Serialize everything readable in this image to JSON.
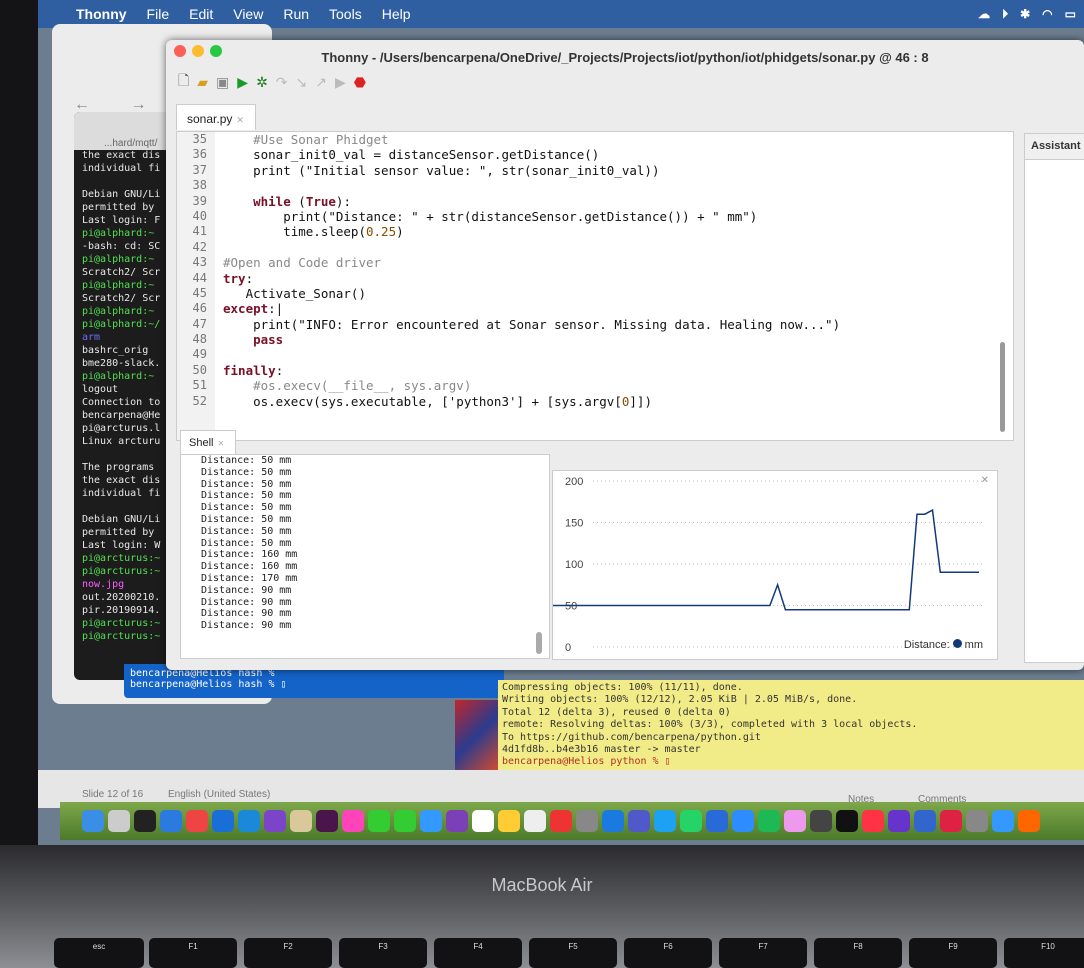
{
  "menubar": {
    "app": "Thonny",
    "items": [
      "File",
      "Edit",
      "View",
      "Run",
      "Tools",
      "Help"
    ]
  },
  "window": {
    "title": "Thonny  -  /Users/bencarpena/OneDrive/_Projects/Projects/iot/python/iot/phidgets/sonar.py  @  46 : 8"
  },
  "browser": {
    "nav": "← → C"
  },
  "editor": {
    "tab": "sonar.py",
    "lines": [
      {
        "n": "35",
        "html": "    <span class='cm'>#Use Sonar Phidget</span>"
      },
      {
        "n": "36",
        "html": "    sonar_init0_val = distanceSensor.getDistance()"
      },
      {
        "n": "37",
        "html": "    print (\"Initial sensor value: \", str(sonar_init0_val))"
      },
      {
        "n": "38",
        "html": ""
      },
      {
        "n": "39",
        "html": "    <span class='kw'>while</span> (<span class='kw'>True</span>):"
      },
      {
        "n": "40",
        "html": "        print(\"Distance: \" + str(distanceSensor.getDistance()) + \" mm\")"
      },
      {
        "n": "41",
        "html": "        time.sleep(<span class='nm'>0.25</span>)"
      },
      {
        "n": "42",
        "html": ""
      },
      {
        "n": "43",
        "html": "<span class='cm'>#Open and Code driver</span>"
      },
      {
        "n": "44",
        "html": "<span class='kw'>try</span>:"
      },
      {
        "n": "45",
        "html": "   Activate_Sonar()"
      },
      {
        "n": "46",
        "html": "<span class='kw'>except</span>:|"
      },
      {
        "n": "47",
        "html": "    print(\"INFO: Error encountered at Sonar sensor. Missing data. Healing now...\")"
      },
      {
        "n": "48",
        "html": "    <span class='kw'>pass</span>"
      },
      {
        "n": "49",
        "html": ""
      },
      {
        "n": "50",
        "html": "<span class='kw'>finally</span>:"
      },
      {
        "n": "51",
        "html": "    <span class='cm'>#os.execv(__file__, sys.argv)</span>"
      },
      {
        "n": "52",
        "html": "    os.execv(sys.executable, ['python3'] + [sys.argv[<span class='nm'>0</span>]])"
      }
    ]
  },
  "assistant": {
    "title": "Assistant"
  },
  "shell": {
    "tab": "Shell",
    "lines": [
      "Distance: 50 mm",
      "Distance: 50 mm",
      "Distance: 50 mm",
      "Distance: 50 mm",
      "Distance: 50 mm",
      "Distance: 50 mm",
      "Distance: 50 mm",
      "Distance: 50 mm",
      "Distance: 160 mm",
      "Distance: 160 mm",
      "Distance: 170 mm",
      "Distance: 90 mm",
      "Distance: 90 mm",
      "Distance: 90 mm",
      "Distance: 90 mm"
    ]
  },
  "plot": {
    "legend_label": "Distance:",
    "legend_unit": "mm",
    "line_color": "#123a7a"
  },
  "chart_data": {
    "type": "line",
    "ylim": [
      0,
      200
    ],
    "yticks": [
      0,
      50,
      100,
      150,
      200
    ],
    "series": [
      {
        "name": "Distance",
        "values": [
          50,
          50,
          50,
          50,
          50,
          50,
          50,
          50,
          50,
          50,
          50,
          50,
          50,
          50,
          50,
          50,
          50,
          50,
          50,
          50,
          50,
          50,
          50,
          50,
          50,
          50,
          50,
          50,
          50,
          75,
          45,
          45,
          45,
          45,
          45,
          45,
          45,
          45,
          45,
          45,
          45,
          45,
          45,
          45,
          45,
          45,
          45,
          160,
          160,
          165,
          90,
          90,
          90,
          90,
          90,
          90
        ]
      }
    ]
  },
  "terminal_left": {
    "title": "...hard/mqtt/",
    "lines": [
      {
        "t": "the exact dis",
        "c": ""
      },
      {
        "t": "individual fi",
        "c": ""
      },
      {
        "t": "",
        "c": ""
      },
      {
        "t": "Debian GNU/Li",
        "c": ""
      },
      {
        "t": "permitted by",
        "c": ""
      },
      {
        "t": "Last login: F",
        "c": ""
      },
      {
        "t": "pi@alphard:~",
        "c": "g"
      },
      {
        "t": "-bash: cd: SC",
        "c": ""
      },
      {
        "t": "pi@alphard:~",
        "c": "g"
      },
      {
        "t": "Scratch2/ Scr",
        "c": ""
      },
      {
        "t": "pi@alphard:~",
        "c": "g"
      },
      {
        "t": "Scratch2/ Scr",
        "c": ""
      },
      {
        "t": "pi@alphard:~",
        "c": "g"
      },
      {
        "t": "pi@alphard:~/",
        "c": "g"
      },
      {
        "t": "arm",
        "c": "b"
      },
      {
        "t": "bashrc_orig",
        "c": ""
      },
      {
        "t": "bme280-slack.",
        "c": ""
      },
      {
        "t": "pi@alphard:~",
        "c": "g"
      },
      {
        "t": "logout",
        "c": ""
      },
      {
        "t": "Connection to",
        "c": ""
      },
      {
        "t": "bencarpena@He",
        "c": ""
      },
      {
        "t": "pi@arcturus.l",
        "c": ""
      },
      {
        "t": "Linux arcturu",
        "c": ""
      },
      {
        "t": "",
        "c": ""
      },
      {
        "t": "The programs",
        "c": ""
      },
      {
        "t": "the exact dis",
        "c": ""
      },
      {
        "t": "individual fi",
        "c": ""
      },
      {
        "t": "",
        "c": ""
      },
      {
        "t": "Debian GNU/Li",
        "c": ""
      },
      {
        "t": "permitted by",
        "c": ""
      },
      {
        "t": "Last login: W",
        "c": ""
      },
      {
        "t": "pi@arcturus:~",
        "c": "g"
      },
      {
        "t": "pi@arcturus:~",
        "c": "g"
      },
      {
        "t": "now.jpg",
        "c": "m"
      },
      {
        "t": "out.20200210.",
        "c": ""
      },
      {
        "t": "pir.20190914.",
        "c": ""
      },
      {
        "t": "pi@arcturus:~",
        "c": "g"
      },
      {
        "t": "pi@arcturus:~",
        "c": "g"
      }
    ]
  },
  "terminal_blue": {
    "lines": [
      "bencarpena@Helios hash %",
      "bencarpena@Helios hash % ▯"
    ]
  },
  "terminal_git": {
    "lines": [
      "Compressing objects: 100% (11/11), done.",
      "Writing objects: 100% (12/12), 2.05 KiB | 2.05 MiB/s, done.",
      "Total 12 (delta 3), reused 0 (delta 0)",
      "remote: Resolving deltas: 100% (3/3), completed with 3 local objects.",
      "To https://github.com/bencarpena/python.git",
      "   4d1fd8b..b4e3b16  master -> master",
      "bencarpena@Helios python % ▯"
    ]
  },
  "ppt": {
    "slide": "Slide 12 of 16",
    "lang": "English (United States)",
    "notes": "Notes",
    "comments": "Comments"
  },
  "laptop": {
    "brand": "MacBook Air",
    "keys": [
      "esc",
      "F1",
      "F2",
      "F3",
      "F4",
      "F5",
      "F6",
      "F7",
      "F8",
      "F9",
      "F10"
    ]
  },
  "dock": {
    "icons": [
      "Finder",
      "Launchpad",
      "Terminal",
      "Safari",
      "Chrome",
      "Outlook",
      "VS Code",
      "Visual Studio",
      "Thonny",
      "Slack",
      "Photos",
      "FaceTime",
      "Messages",
      "OneDrive",
      "OneNote",
      "Calendar",
      "Notes",
      "Reminders",
      "Maps",
      "Settings",
      "App Store",
      "Teams",
      "Twitter",
      "WhatsApp",
      "V2",
      "Zoom",
      "Spotify",
      "Slack2",
      "QR",
      "TV",
      "Music",
      "iMovie",
      "Keynote",
      "PowerPoint",
      "Calculator",
      "Xcode",
      "Swift"
    ]
  }
}
